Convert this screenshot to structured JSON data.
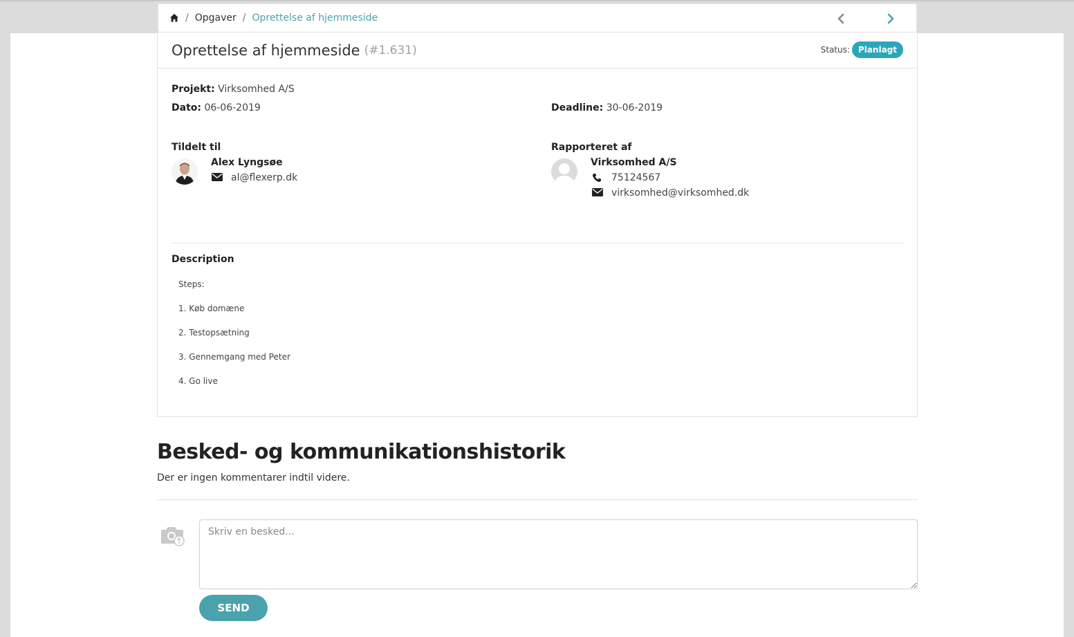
{
  "breadcrumb": {
    "items": [
      {
        "label": "Opgaver"
      },
      {
        "label": "Oprettelse af hjemmeside"
      }
    ],
    "separator": "/"
  },
  "task": {
    "title": "Oprettelse af hjemmeside",
    "id": "(#1.631)",
    "status_label": "Status:",
    "status_value": "Planlagt",
    "status_color": "#2ba6b9",
    "project_label": "Projekt:",
    "project_value": "Virksomhed A/S",
    "date_label": "Dato:",
    "date_value": "06-06-2019",
    "deadline_label": "Deadline:",
    "deadline_value": "30-06-2019"
  },
  "assigned": {
    "label": "Tildelt til",
    "name": "Alex Lyngsøe",
    "email": "al@flexerp.dk"
  },
  "reporter": {
    "label": "Rapporteret af",
    "name": "Virksomhed A/S",
    "phone": "75124567",
    "email": "virksomhed@virksomhed.dk"
  },
  "description": {
    "label": "Description",
    "lines": [
      "Steps:",
      "1. Køb domæne",
      "2. Testopsætning",
      "3. Gennemgang med Peter",
      "4. Go live"
    ]
  },
  "history": {
    "title": "Besked- og kommunikationshistorik",
    "empty_text": "Der er ingen kommentarer indtil videre.",
    "input_placeholder": "Skriv en besked...",
    "send_label": "SEND"
  },
  "colors": {
    "accent": "#4aa3ac",
    "badge": "#2ba6b9"
  }
}
